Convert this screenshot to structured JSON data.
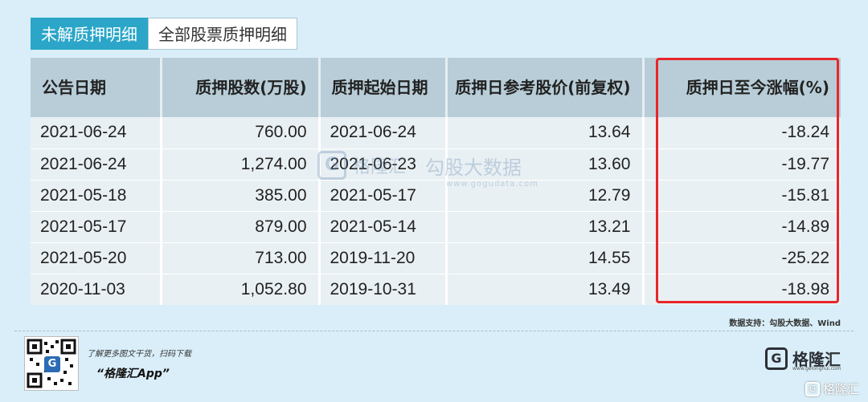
{
  "tabs": [
    {
      "label": "未解质押明细",
      "active": true
    },
    {
      "label": "全部股票质押明细",
      "active": false
    }
  ],
  "table": {
    "headers": [
      {
        "text": "公告日期",
        "align": "left"
      },
      {
        "text": "质押股数(万股)",
        "align": "right"
      },
      {
        "text": "质押起始日期",
        "align": "left"
      },
      {
        "text": "质押日参考股价(前复权)",
        "align": "right"
      },
      {
        "text": "质押日至今涨幅(%)",
        "align": "right"
      }
    ],
    "rows": [
      [
        "2021-06-24",
        "760.00",
        "2021-06-24",
        "13.64",
        "-18.24"
      ],
      [
        "2021-06-24",
        "1,274.00",
        "2021-06-23",
        "13.60",
        "-19.77"
      ],
      [
        "2021-05-18",
        "385.00",
        "2021-05-17",
        "12.79",
        "-15.81"
      ],
      [
        "2021-05-17",
        "879.00",
        "2021-05-14",
        "13.21",
        "-14.89"
      ],
      [
        "2021-05-20",
        "713.00",
        "2019-11-20",
        "14.55",
        "-25.22"
      ],
      [
        "2020-11-03",
        "1,052.80",
        "2019-10-31",
        "13.49",
        "-18.98"
      ]
    ]
  },
  "watermark": {
    "logo_char": "G",
    "name": "格隆汇",
    "text": "勾股大数据",
    "url": "www.gogudata.com"
  },
  "source": "数据支持：勾股大数据、Wind",
  "footer": {
    "promo": "了解更多图文干货，扫码下载",
    "app_name": "“格隆汇App”",
    "qr_icon": "qr-code-icon",
    "brand_char": "G",
    "brand_name": "格隆汇",
    "brand_url": "www.gelonghui.com",
    "corner_text": "格隆汇"
  },
  "colors": {
    "background": "#d9eef8",
    "tab_active": "#2ba6c8",
    "header_bg": "#b8cdd7",
    "highlight": "#e8262a"
  }
}
